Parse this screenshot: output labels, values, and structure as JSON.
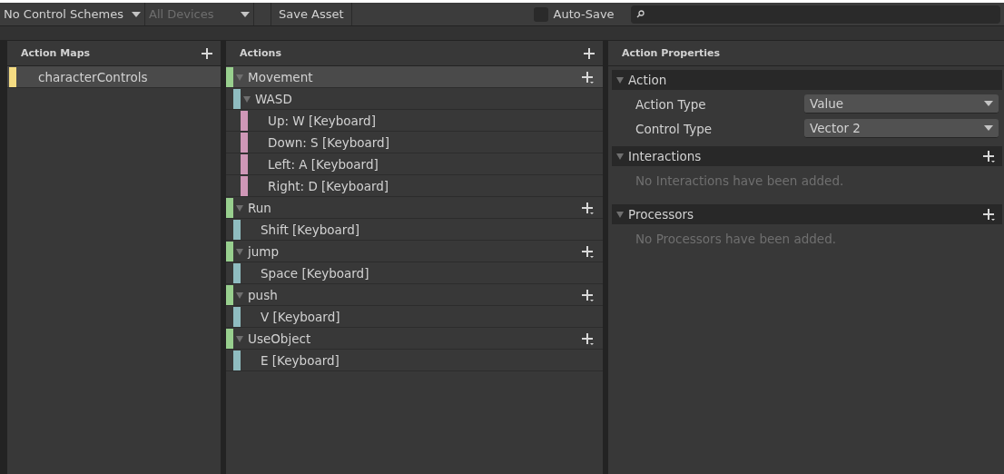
{
  "toolbar": {
    "control_schemes": "No Control Schemes",
    "devices": {
      "label": "All Devices",
      "disabled": true
    },
    "save_button": "Save Asset",
    "auto_save": {
      "label": "Auto-Save",
      "checked": false
    }
  },
  "action_maps": {
    "title": "Action Maps",
    "items": [
      {
        "label": "characterControls",
        "selected": true,
        "color": "#f5dc82"
      }
    ]
  },
  "actions": {
    "title": "Actions",
    "items": [
      {
        "label": "Movement",
        "kind": "action",
        "color": "#98cf8e",
        "selected": true,
        "expanded": true,
        "children": [
          {
            "label": "WASD",
            "kind": "composite",
            "color": "#8fbcc0",
            "selected": false,
            "expanded": true,
            "children": [
              {
                "label": "Up: W [Keyboard]",
                "kind": "part",
                "color": "#cf97b7",
                "selected": false
              },
              {
                "label": "Down: S [Keyboard]",
                "kind": "part",
                "color": "#cf97b7",
                "selected": false
              },
              {
                "label": "Left: A [Keyboard]",
                "kind": "part",
                "color": "#cf97b7",
                "selected": false
              },
              {
                "label": "Right: D [Keyboard]",
                "kind": "part",
                "color": "#cf97b7",
                "selected": false
              }
            ]
          }
        ]
      },
      {
        "label": "Run",
        "kind": "action",
        "color": "#98cf8e",
        "selected": false,
        "expanded": true,
        "children": [
          {
            "label": "Shift [Keyboard]",
            "kind": "binding",
            "color": "#8fbcc0",
            "selected": false
          }
        ]
      },
      {
        "label": "jump",
        "kind": "action",
        "color": "#98cf8e",
        "selected": false,
        "expanded": true,
        "children": [
          {
            "label": "Space [Keyboard]",
            "kind": "binding",
            "color": "#8fbcc0",
            "selected": false
          }
        ]
      },
      {
        "label": "push",
        "kind": "action",
        "color": "#98cf8e",
        "selected": false,
        "expanded": true,
        "children": [
          {
            "label": "V [Keyboard]",
            "kind": "binding",
            "color": "#8fbcc0",
            "selected": false
          }
        ]
      },
      {
        "label": "UseObject",
        "kind": "action",
        "color": "#98cf8e",
        "selected": false,
        "expanded": true,
        "children": [
          {
            "label": "E [Keyboard]",
            "kind": "binding",
            "color": "#8fbcc0",
            "selected": false
          }
        ]
      }
    ]
  },
  "properties": {
    "title": "Action Properties",
    "sections": [
      {
        "title": "Action",
        "expanded": true,
        "addable": false,
        "fields": [
          {
            "label": "Action Type",
            "value": "Value"
          },
          {
            "label": "Control Type",
            "value": "Vector 2"
          }
        ]
      },
      {
        "title": "Interactions",
        "expanded": true,
        "addable": true,
        "empty_message": "No Interactions have been added."
      },
      {
        "title": "Processors",
        "expanded": true,
        "addable": true,
        "empty_message": "No Processors have been added."
      }
    ]
  }
}
